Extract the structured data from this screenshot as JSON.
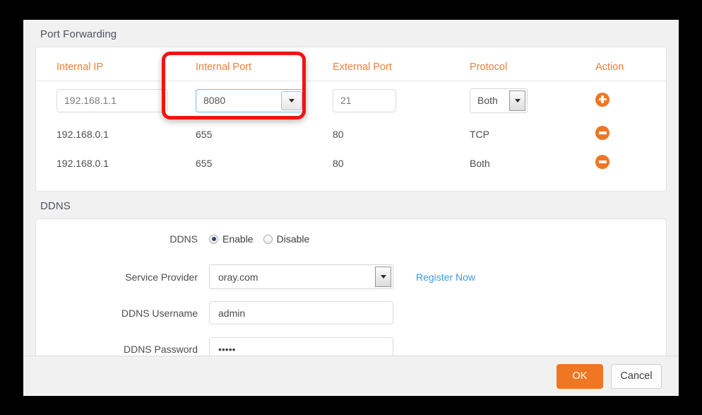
{
  "dialog": {
    "port_forwarding": {
      "section_title": "Port Forwarding",
      "columns": [
        "Internal IP",
        "Internal Port",
        "External Port",
        "Protocol",
        "Action"
      ],
      "input_row": {
        "internal_ip": "192.168.1.1",
        "internal_port": "8080",
        "external_port": "21",
        "protocol": "Both",
        "action_icon": "add-icon"
      },
      "rows": [
        {
          "internal_ip": "192.168.0.1",
          "internal_port": "655",
          "external_port": "80",
          "protocol": "TCP",
          "action_icon": "remove-icon"
        },
        {
          "internal_ip": "192.168.0.1",
          "internal_port": "655",
          "external_port": "80",
          "protocol": "Both",
          "action_icon": "remove-icon"
        }
      ]
    },
    "ddns": {
      "section_title": "DDNS",
      "ddns_label": "DDNS",
      "enable_label": "Enable",
      "disable_label": "Disable",
      "enabled": true,
      "service_provider_label": "Service Provider",
      "service_provider_value": "oray.com",
      "register_link": "Register Now",
      "username_label": "DDNS Username",
      "username_value": "admin",
      "password_label": "DDNS Password",
      "password_value": "•••••"
    },
    "footer": {
      "ok_label": "OK",
      "cancel_label": "Cancel"
    }
  },
  "annotation": {
    "highlight_color": "#f01414",
    "target": "internal-port-column"
  },
  "colors": {
    "accent_orange": "#ef7622",
    "header_orange": "#ee7d3c",
    "link_blue": "#3a9ae8",
    "panel_bg": "#f1f1f1"
  }
}
